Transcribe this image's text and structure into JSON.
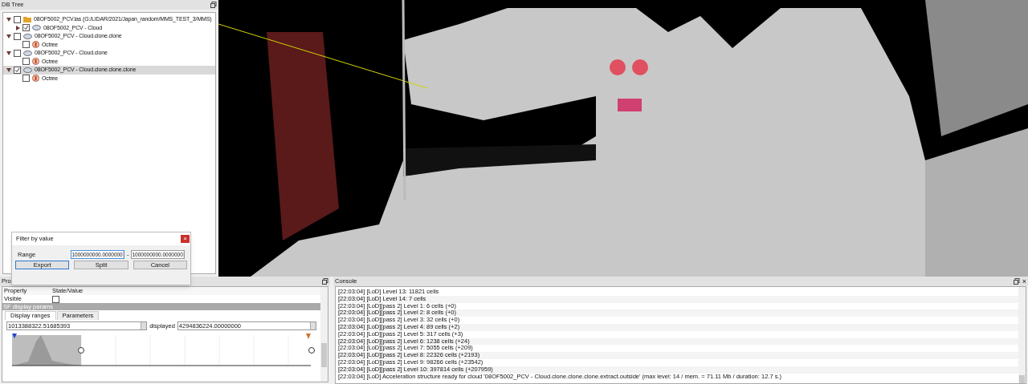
{
  "db_tree": {
    "title": "DB Tree",
    "items": [
      {
        "label": "08OF5002_PCV.las (G:/LIDAR/2021/Japan_random/MMS_TEST_3/MMS)",
        "kind": "folder",
        "checked": false,
        "expanded": true,
        "selected": false,
        "children": [
          {
            "label": "08OF5002_PCV - Cloud",
            "kind": "cloud",
            "checked": true,
            "expanded": false,
            "selected": false
          }
        ]
      },
      {
        "label": "08OF5002_PCV - Cloud.clone.clone",
        "kind": "cloud",
        "checked": false,
        "expanded": true,
        "selected": false,
        "children": [
          {
            "label": "Octree",
            "kind": "octree",
            "checked": false,
            "selected": false
          }
        ]
      },
      {
        "label": "08OF5002_PCV - Cloud.clone",
        "kind": "cloud",
        "checked": false,
        "expanded": true,
        "selected": false,
        "children": [
          {
            "label": "Octree",
            "kind": "octree",
            "checked": false,
            "selected": false
          }
        ]
      },
      {
        "label": "08OF5002_PCV - Cloud.clone.clone.clone",
        "kind": "cloud",
        "checked": true,
        "expanded": true,
        "selected": true,
        "children": [
          {
            "label": "Octree",
            "kind": "octree",
            "checked": false,
            "selected": false
          }
        ]
      }
    ]
  },
  "filter_dialog": {
    "title": "Filter by value",
    "close": "×",
    "range_label": "Range",
    "range_min": "1000000000.0000000",
    "separator": "-",
    "range_max": "1000000000.0000000",
    "buttons": [
      {
        "label": "Export",
        "selected": true
      },
      {
        "label": "Split",
        "selected": false
      },
      {
        "label": "Cancel",
        "selected": false
      }
    ]
  },
  "properties": {
    "title": "Pro",
    "columns": [
      "Property",
      "State/Value"
    ],
    "visible_label": "Visible",
    "visible_checked": false,
    "section": "SF display params",
    "tabs": [
      {
        "label": "Display ranges",
        "selected": true
      },
      {
        "label": "Parameters",
        "selected": false
      }
    ],
    "range_value": "1013388322.51685393",
    "displayed_label": "displayed",
    "displayed_value": "4294836224.00000000"
  },
  "console": {
    "title": "Console",
    "close": "×",
    "lines": [
      "[22:03:04] [LoD] Level 13: 11821 cells",
      "[22:03:04] [LoD] Level 14: 7 cells",
      "[22:03:04] [LoD][pass 2] Level 1: 6 cells (+0)",
      "[22:03:04] [LoD][pass 2] Level 2: 8 cells (+0)",
      "[22:03:04] [LoD][pass 2] Level 3: 32 cells (+0)",
      "[22:03:04] [LoD][pass 2] Level 4: 89 cells (+2)",
      "[22:03:04] [LoD][pass 2] Level 5: 317 cells (+3)",
      "[22:03:04] [LoD][pass 2] Level 6: 1238 cells (+24)",
      "[22:03:04] [LoD][pass 2] Level 7: 5055 cells (+209)",
      "[22:03:04] [LoD][pass 2] Level 8: 22326 cells (+2193)",
      "[22:03:04] [LoD][pass 2] Level 9: 98266 cells (+23542)",
      "[22:03:04] [LoD][pass 2] Level 10: 397814 cells (+207959)",
      "[22:03:04] [LoD] Acceleration structure ready for cloud '08OF5002_PCV - Cloud.clone.clone.clone.extract.outside' (max level: 14 / mem. = 71.11 Mb / duration: 12.7 s.)"
    ]
  }
}
